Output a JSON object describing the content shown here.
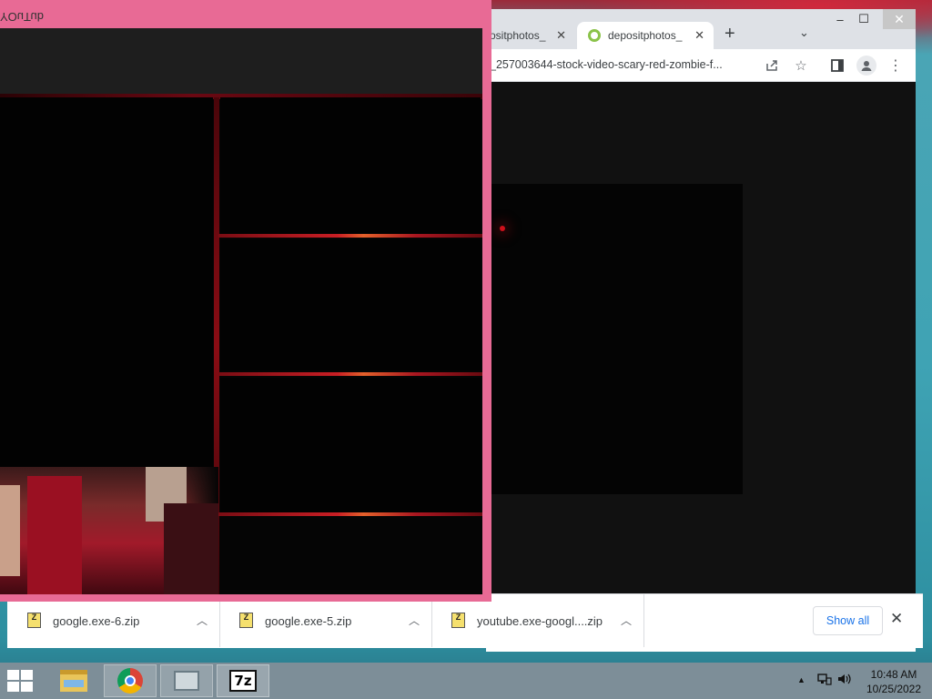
{
  "pink_window": {
    "title": "YOuTub"
  },
  "chrome": {
    "window_buttons": {
      "minimize": "–",
      "maximize": "☐",
      "close": "✕"
    },
    "tabs": [
      {
        "title": "ositphotos_",
        "close": "✕"
      },
      {
        "title": "depositphotos_",
        "close": "✕"
      }
    ],
    "new_tab": "+",
    "tab_search": "⌄",
    "url": "_257003644-stock-video-scary-red-zombie-f...",
    "downloads": [
      {
        "name": "google.exe-6.zip",
        "icon_text": "Z"
      },
      {
        "name": "google.exe-5.zip",
        "icon_text": "Z"
      },
      {
        "name": "youtube.exe-googl....zip",
        "icon_text": "Z"
      }
    ],
    "show_all": "Show all",
    "shelf_close": "✕"
  },
  "taskbar": {
    "apps": [
      "file-explorer",
      "google-chrome",
      "resource-monitor",
      "7-zip"
    ],
    "sevenzip_label": "7z",
    "time": "10:48 AM",
    "date": "10/25/2022"
  },
  "colors": {
    "pink_frame": "#e86a95",
    "taskbar": "#7d8e98",
    "link_blue": "#1a73e8"
  }
}
